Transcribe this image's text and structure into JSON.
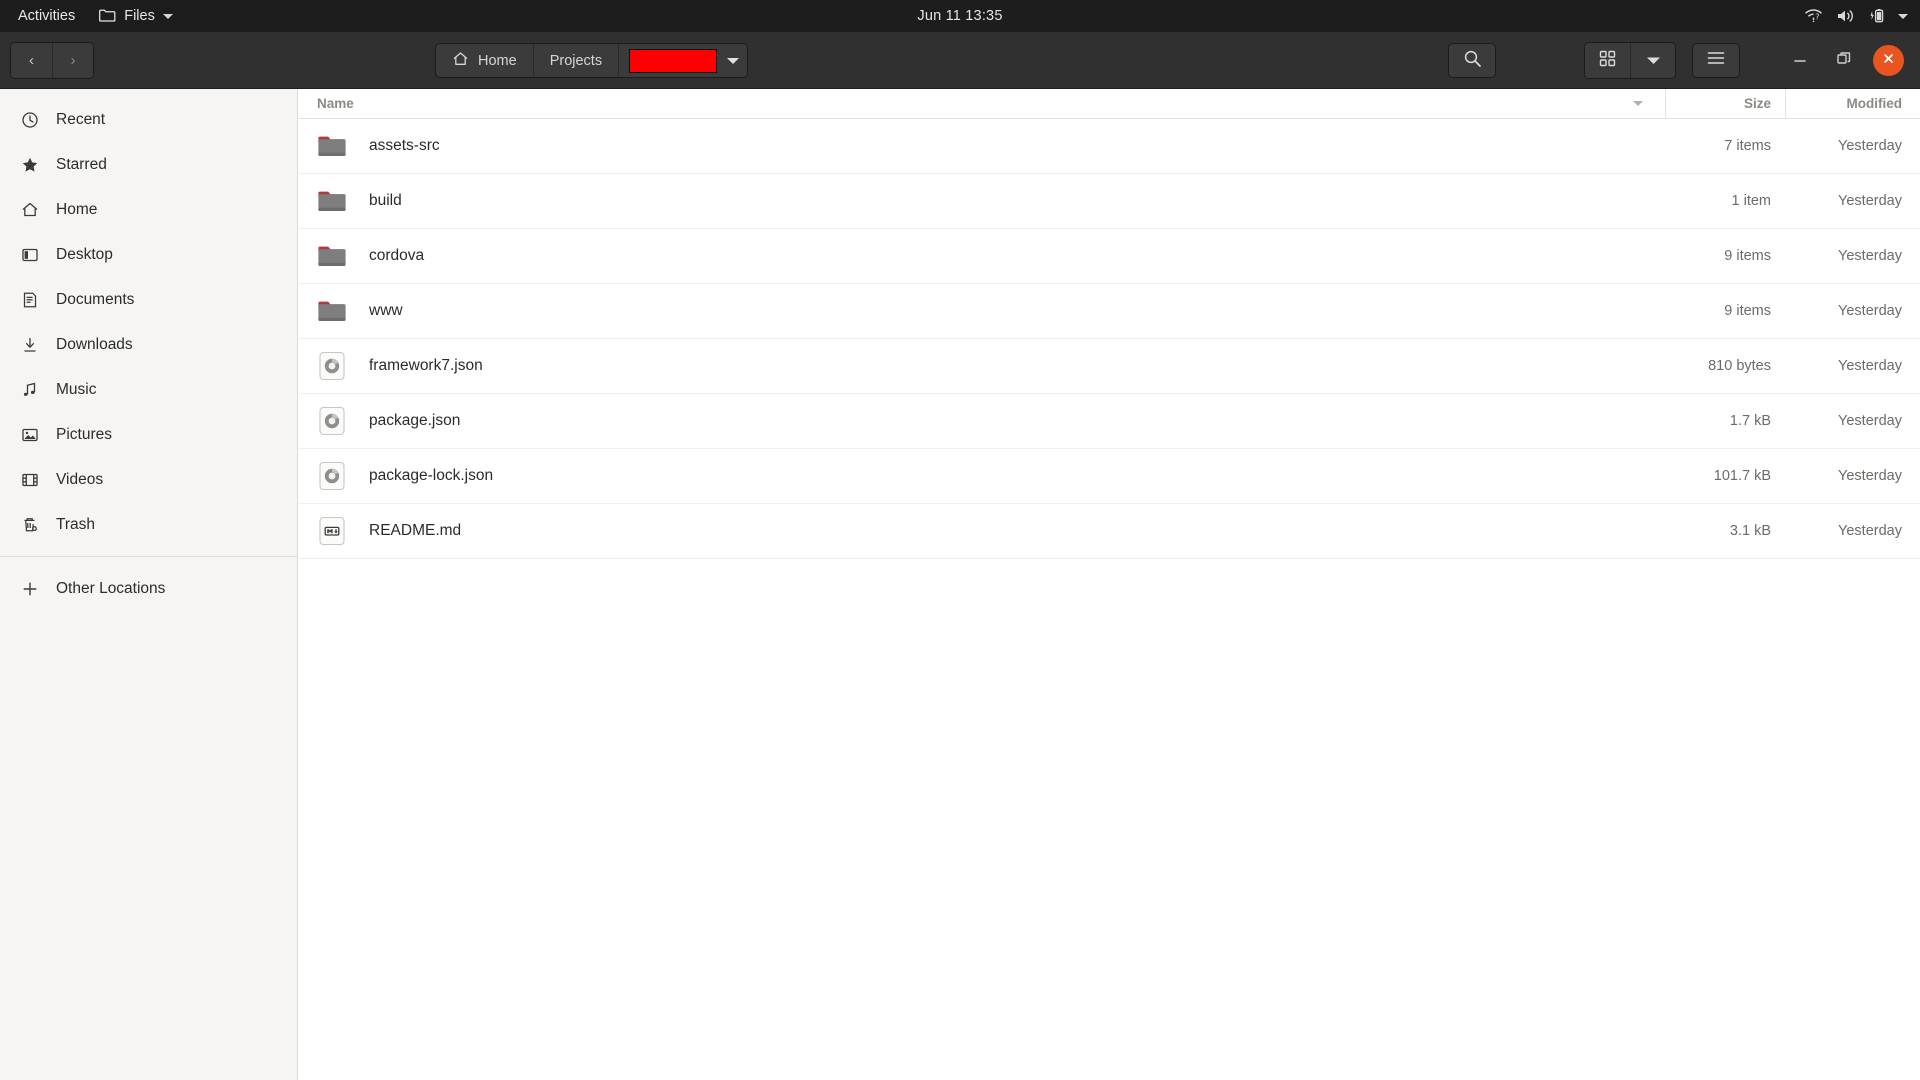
{
  "topbar": {
    "activities": "Activities",
    "app_name": "Files",
    "clock": "Jun 11  13:35",
    "tray_icons": [
      "wifi-offline-icon",
      "volume-icon",
      "battery-charging-icon",
      "chevron-down-icon"
    ]
  },
  "headerbar": {
    "back_label": "‹",
    "forward_label": "›",
    "breadcrumbs": [
      {
        "label": "Home",
        "icon": "home-icon",
        "redacted": false
      },
      {
        "label": "Projects",
        "icon": "",
        "redacted": false
      },
      {
        "label": "",
        "icon": "",
        "redacted": true
      }
    ],
    "search_icon": "search-icon",
    "view_grid_icon": "grid-view-icon",
    "view_dropdown_icon": "chevron-down-icon",
    "menu_icon": "hamburger-menu-icon",
    "minimize_icon": "minimize-icon",
    "maximize_icon": "maximize-icon",
    "close_icon": "close-icon",
    "accent_close_color": "#e95420"
  },
  "sidebar": {
    "items": [
      {
        "label": "Recent",
        "icon": "clock-icon"
      },
      {
        "label": "Starred",
        "icon": "star-icon"
      },
      {
        "label": "Home",
        "icon": "home-icon"
      },
      {
        "label": "Desktop",
        "icon": "desktop-icon"
      },
      {
        "label": "Documents",
        "icon": "document-icon"
      },
      {
        "label": "Downloads",
        "icon": "download-icon"
      },
      {
        "label": "Music",
        "icon": "music-note-icon"
      },
      {
        "label": "Pictures",
        "icon": "picture-icon"
      },
      {
        "label": "Videos",
        "icon": "video-icon"
      },
      {
        "label": "Trash",
        "icon": "trash-icon"
      }
    ],
    "other_locations": {
      "label": "Other Locations",
      "icon": "plus-icon"
    }
  },
  "filelist": {
    "columns": {
      "name": "Name",
      "size": "Size",
      "modified": "Modified"
    },
    "sort_column": "Name",
    "rows": [
      {
        "name": "assets-src",
        "size": "7 items",
        "modified": "Yesterday",
        "icon": "folder-icon"
      },
      {
        "name": "build",
        "size": "1 item",
        "modified": "Yesterday",
        "icon": "folder-icon"
      },
      {
        "name": "cordova",
        "size": "9 items",
        "modified": "Yesterday",
        "icon": "folder-icon"
      },
      {
        "name": "www",
        "size": "9 items",
        "modified": "Yesterday",
        "icon": "folder-icon"
      },
      {
        "name": "framework7.json",
        "size": "810 bytes",
        "modified": "Yesterday",
        "icon": "json-file-icon"
      },
      {
        "name": "package.json",
        "size": "1.7 kB",
        "modified": "Yesterday",
        "icon": "json-file-icon"
      },
      {
        "name": "package-lock.json",
        "size": "101.7 kB",
        "modified": "Yesterday",
        "icon": "json-file-icon"
      },
      {
        "name": "README.md",
        "size": "3.1 kB",
        "modified": "Yesterday",
        "icon": "markdown-file-icon"
      }
    ]
  }
}
